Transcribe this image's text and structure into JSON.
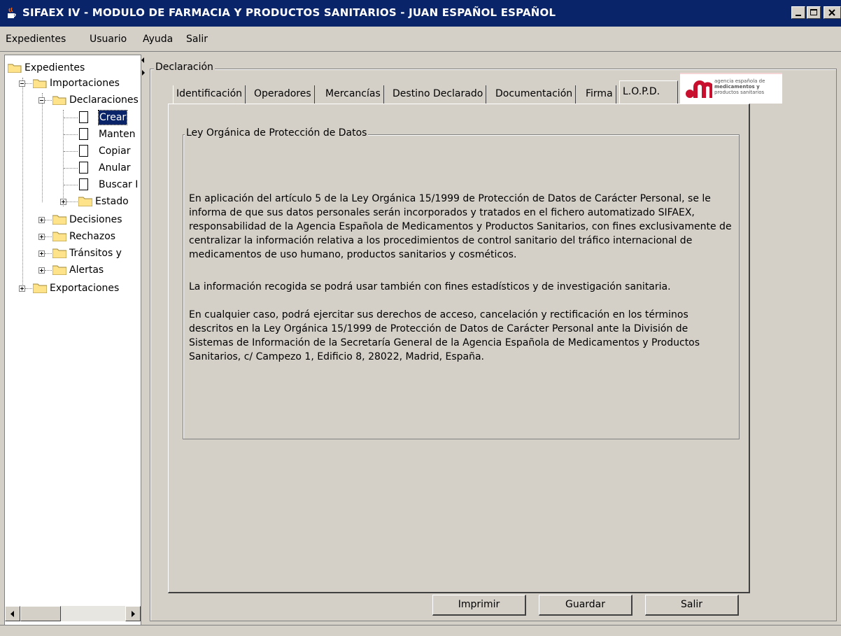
{
  "window": {
    "title": "SIFAEX IV - MODULO DE FARMACIA Y PRODUCTOS SANITARIOS - JUAN ESPAÑOL ESPAÑOL",
    "app_icon": "java-cup-icon",
    "controls": [
      "minimize",
      "maximize",
      "close"
    ]
  },
  "menu": {
    "items": [
      "Expedientes",
      "Usuario",
      "Ayuda",
      "Salir"
    ]
  },
  "tree": {
    "root": "Expedientes",
    "importaciones": "Importaciones",
    "declaraciones": "Declaraciones",
    "declaraciones_items": [
      "Crear",
      "Manten",
      "Copiar",
      "Anular",
      "Buscar I"
    ],
    "selected": "Crear",
    "estado": "Estado",
    "importaciones_others": [
      "Decisiones",
      "Rechazos",
      "Tránsitos y",
      "Alertas"
    ],
    "exportaciones": "Exportaciones"
  },
  "main": {
    "group_title": "Declaración",
    "tabs": [
      "Identificación",
      "Operadores",
      "Mercancías",
      "Destino Declarado",
      "Documentación",
      "Firma",
      "L.O.P.D."
    ],
    "active_tab": "L.O.P.D.",
    "logo": {
      "line1": "agencia española de",
      "line2": "medicamentos y",
      "line3": "productos sanitarios",
      "color": "#c8102e"
    },
    "lopd": {
      "title": "Ley Orgánica de Protección de Datos",
      "paragraph1": "En aplicación del artículo 5 de la Ley Orgánica 15/1999 de Protección de Datos de Carácter Personal, se le informa de que sus datos personales serán incorporados y tratados en el fichero automatizado SIFAEX, responsabilidad de la Agencia Española de Medicamentos y Productos Sanitarios, con fines exclusivamente de centralizar la información relativa a los procedimientos de control sanitario del tráfico internacional de medicamentos de uso humano, productos sanitarios y cosméticos.",
      "paragraph2": "La información recogida se podrá usar también con fines estadísticos y de investigación sanitaria.",
      "paragraph3": "En cualquier caso, podrá ejercitar sus derechos de acceso, cancelación y rectificación en los términos descritos en la Ley Orgánica 15/1999 de Protección de Datos de Carácter Personal ante la División de Sistemas de Información de la Secretaría General de la Agencia Española de Medicamentos y Productos Sanitarios, c/ Campezo 1, Edificio 8, 28022, Madrid, España."
    },
    "buttons": {
      "print": "Imprimir",
      "save": "Guardar",
      "exit": "Salir"
    }
  },
  "colors": {
    "titlebar": "#0a246a",
    "window_bg": "#d4d0c8",
    "folder": "#ffe38a"
  }
}
